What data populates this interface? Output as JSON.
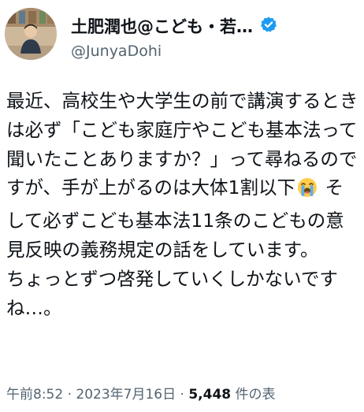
{
  "user": {
    "display_name": "土肥潤也@こども・若…",
    "handle": "@JunyaDohi",
    "verified_icon": "verified-badge-icon",
    "verified_color": "#1d9bf0"
  },
  "tweet": {
    "text_before_emoji": "最近、高校生や大学生の前で講演するときは必ず「こども家庭庁やこども基本法って聞いたことありますか？」って尋ねるのですが、手が上がるのは大体1割以下",
    "emoji": "loudly-crying-face-icon",
    "text_after_emoji": " そして必ずこども基本法11条のこどもの意見反映の義務規定の話をしています。\nちょっとずつ啓発していくしかないですね…。"
  },
  "meta": {
    "time": "午前8:52",
    "separator1": " · ",
    "date": "2023年7月16日",
    "separator2": " · ",
    "view_count": "5,448",
    "view_label": " 件の表"
  }
}
